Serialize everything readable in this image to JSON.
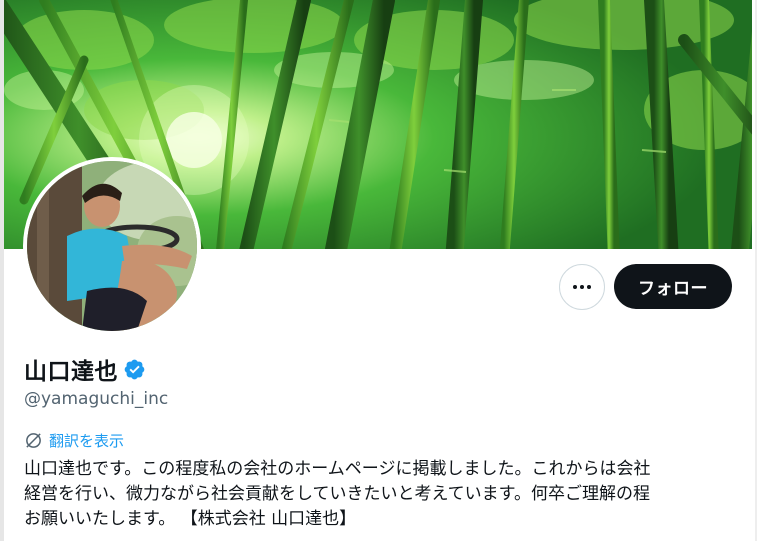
{
  "profile": {
    "display_name": "山口達也",
    "handle": "@yamaguchi_inc",
    "verified": true,
    "translate_label": "翻訳を表示",
    "bio_lines": [
      "山口達也です。この程度私の会社のホームページに掲載しました。これからは会社",
      "経営を行い、微力ながら社会貢献をしていきたいと考えています。何卒ご理解の程",
      "お願いいたします。 【株式会社 山口達也】"
    ]
  },
  "actions": {
    "follow_label": "フォロー",
    "more_icon": "more-horizontal-icon"
  },
  "colors": {
    "follow_bg": "#0f1419",
    "link": "#1d9bf0",
    "verified": "#1d9bf0",
    "secondary_text": "#536471"
  }
}
